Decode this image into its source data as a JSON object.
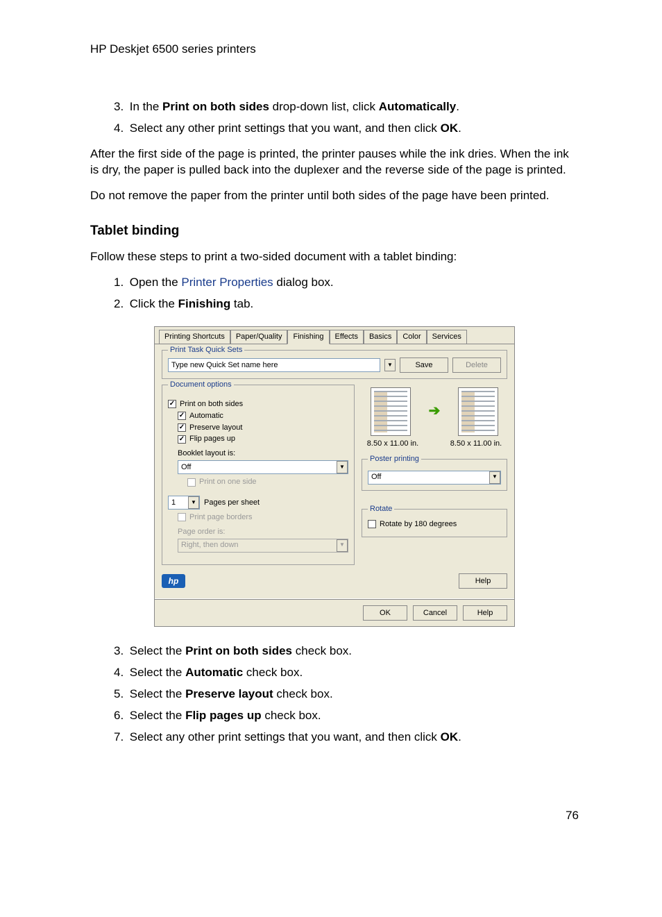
{
  "header": {
    "title": "HP Deskjet 6500 series printers"
  },
  "steps_a": [
    {
      "num": "3.",
      "pre": "In the ",
      "bold1": "Print on both sides",
      "mid": " drop-down list, click ",
      "bold2": "Automatically",
      "post": "."
    },
    {
      "num": "4.",
      "pre": "Select any other print settings that you want, and then click ",
      "bold1": "OK",
      "mid": "",
      "bold2": "",
      "post": "."
    }
  ],
  "para1": "After the first side of the page is printed, the printer pauses while the ink dries. When the ink is dry, the paper is pulled back into the duplexer and the reverse side of the page is printed.",
  "para2": "Do not remove the paper from the printer until both sides of the page have been printed.",
  "heading": "Tablet binding",
  "para3": "Follow these steps to print a two-sided document with a tablet binding:",
  "steps_b": {
    "s1_pre": "Open the ",
    "s1_link": "Printer Properties",
    "s1_post": " dialog box.",
    "s2_pre": "Click the ",
    "s2_bold": "Finishing",
    "s2_post": " tab."
  },
  "dialog": {
    "tabs": [
      "Printing Shortcuts",
      "Paper/Quality",
      "Finishing",
      "Effects",
      "Basics",
      "Color",
      "Services"
    ],
    "active_tab": 2,
    "qset": {
      "group_title": "Print Task Quick Sets",
      "placeholder": "Type new Quick Set name here",
      "save": "Save",
      "delete": "Delete"
    },
    "doc": {
      "group_title": "Document options",
      "chk_print_both": "Print on both sides",
      "chk_auto": "Automatic",
      "chk_preserve": "Preserve layout",
      "chk_flip": "Flip pages up",
      "booklet_label": "Booklet layout is:",
      "booklet_value": "Off",
      "chk_print_one": "Print on one side",
      "pages_per_sheet_value": "1",
      "pages_per_sheet_label": "Pages per sheet",
      "chk_borders": "Print page borders",
      "page_order_label": "Page order is:",
      "page_order_value": "Right, then down"
    },
    "preview": {
      "dim1": "8.50 x 11.00 in.",
      "dim2": "8.50 x 11.00 in."
    },
    "poster": {
      "group_title": "Poster printing",
      "value": "Off"
    },
    "rotate": {
      "group_title": "Rotate",
      "chk": "Rotate by 180 degrees"
    },
    "hp_logo": "hp",
    "help": "Help",
    "ok": "OK",
    "cancel": "Cancel",
    "help2": "Help"
  },
  "steps_c": [
    {
      "num": "3.",
      "pre": "Select the ",
      "bold": "Print on both sides",
      "post": " check box."
    },
    {
      "num": "4.",
      "pre": "Select the ",
      "bold": "Automatic",
      "post": " check box."
    },
    {
      "num": "5.",
      "pre": "Select the ",
      "bold": "Preserve layout",
      "post": " check box."
    },
    {
      "num": "6.",
      "pre": "Select the ",
      "bold": "Flip pages up",
      "post": " check box."
    },
    {
      "num": "7.",
      "pre": "Select any other print settings that you want, and then click ",
      "bold": "OK",
      "post": "."
    }
  ],
  "page_number": "76"
}
